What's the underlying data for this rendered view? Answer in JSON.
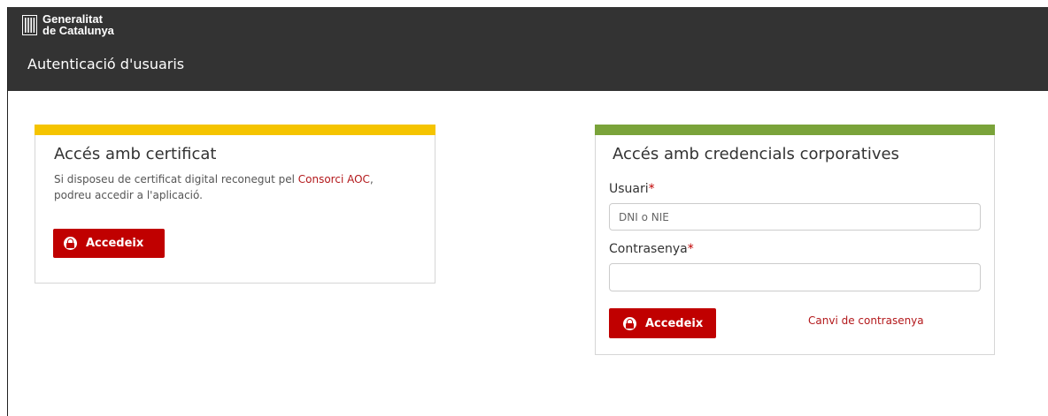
{
  "header": {
    "logo_line1": "Generalitat",
    "logo_line2": "de Catalunya",
    "app_title": "Autenticació d'usuaris",
    "background_color": "#333333"
  },
  "certificate_card": {
    "accent_color": "#f5c400",
    "title": "Accés amb certificat",
    "desc_prefix": "Si disposeu de certificat digital reconegut pel ",
    "desc_link": "Consorci AOC",
    "desc_mid": ",",
    "desc_line2": "podreu accedir a l'aplicació.",
    "button_label": "Accedeix",
    "button_icon": "lock-icon"
  },
  "credentials_card": {
    "accent_color": "#7aa33a",
    "title": "Accés amb credencials corporatives",
    "user_label": "Usuari",
    "user_required": "*",
    "user_placeholder": "DNI o NIE",
    "user_value": "",
    "password_label": "Contrasenya",
    "password_required": "*",
    "password_value": "",
    "button_label": "Accedeix",
    "button_icon": "lock-icon",
    "change_password_link": "Canvi de contrasenya"
  },
  "colors": {
    "primary_button": "#c00000",
    "link": "#b3181b"
  }
}
